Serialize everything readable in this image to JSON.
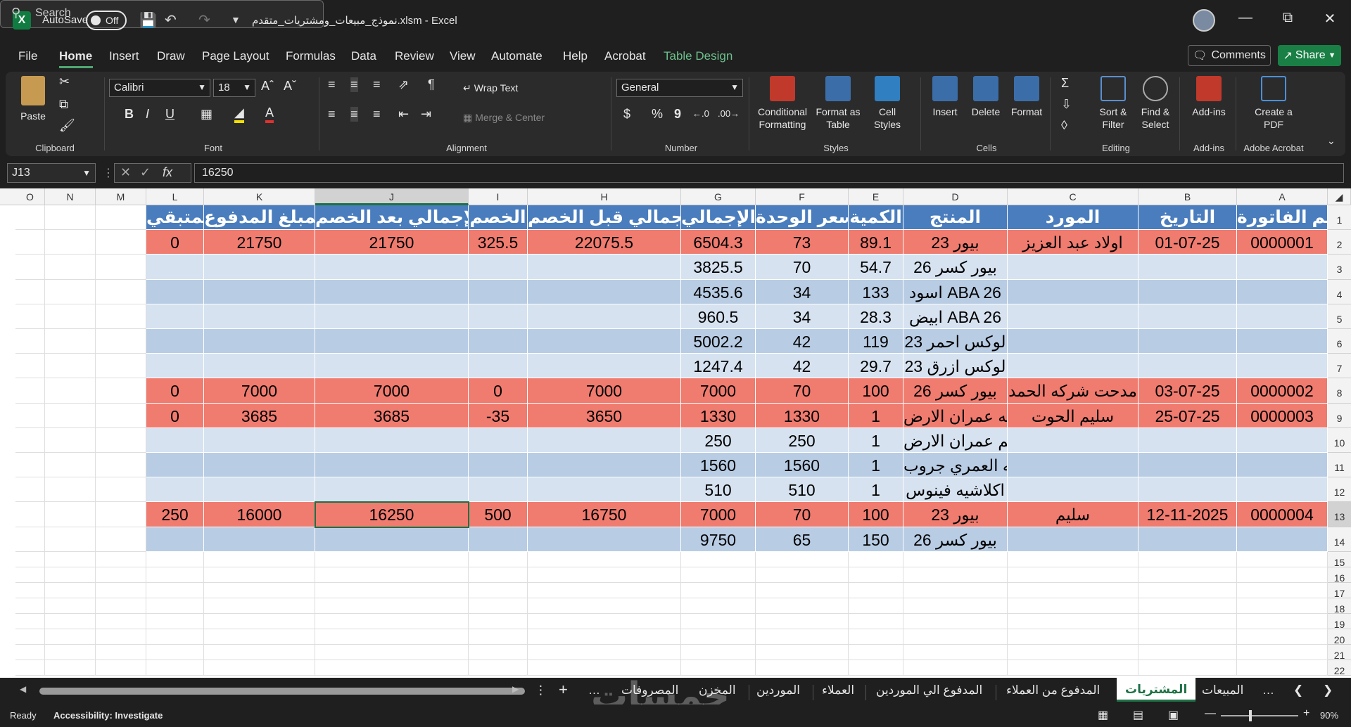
{
  "title_bar": {
    "app_icon": "X",
    "autosave_label": "AutoSave",
    "autosave_state": "Off",
    "file_title": "نموذج_مبيعات_ومشتريات_متقدم.xlsm  -  Excel",
    "search_placeholder": "Search",
    "search_icon": "search-icon"
  },
  "menu": {
    "tabs": [
      "File",
      "Home",
      "Insert",
      "Draw",
      "Page Layout",
      "Formulas",
      "Data",
      "Review",
      "View",
      "Automate",
      "Help",
      "Acrobat",
      "Table Design"
    ],
    "active": "Home",
    "comments_label": "Comments",
    "share_label": "Share"
  },
  "ribbon": {
    "clipboard": {
      "paste": "Paste",
      "label": "Clipboard"
    },
    "font": {
      "name": "Calibri",
      "size": "18",
      "label": "Font",
      "bold": "B",
      "italic": "I",
      "underline": "U"
    },
    "alignment": {
      "wrap_text": "Wrap Text",
      "merge_center": "Merge & Center",
      "label": "Alignment"
    },
    "number": {
      "format": "General",
      "label": "Number",
      "currency": "$",
      "percent": "%",
      "comma": "9"
    },
    "styles": {
      "conditional": "Conditional Formatting",
      "format_table": "Format as Table",
      "cell_styles": "Cell Styles",
      "label": "Styles"
    },
    "cells": {
      "insert": "Insert",
      "delete": "Delete",
      "format": "Format",
      "label": "Cells"
    },
    "editing": {
      "sort_filter": "Sort & Filter",
      "find_select": "Find & Select",
      "label": "Editing"
    },
    "addins": {
      "addins": "Add-ins",
      "label": "Add-ins"
    },
    "acrobat": {
      "create_pdf": "Create a PDF",
      "label": "Adobe Acrobat"
    }
  },
  "formula_bar": {
    "name_box": "J13",
    "fx": "fx",
    "value": "16250"
  },
  "columns": [
    "O",
    "N",
    "M",
    "L",
    "K",
    "J",
    "I",
    "H",
    "G",
    "F",
    "E",
    "D",
    "C",
    "B",
    "A"
  ],
  "selected_column": "J",
  "selected_row": "13",
  "table": {
    "headers": [
      "رقم الفاتورة",
      "التاريخ",
      "المورد",
      "المنتج",
      "الكمية",
      "سعر الوحدة",
      "الإجمالي",
      "الإجمالي قبل الخصم",
      "الخصم",
      "الإجمالي بعد الخصم",
      "المبلغ المدفوع",
      "المتبقي"
    ],
    "rows": [
      {
        "row": "2",
        "style": "red",
        "cells": [
          "0000001",
          "01-07-25",
          "اولاد عبد العزيز",
          "بيور 23",
          "89.1",
          "73",
          "6504.3",
          "22075.5",
          "325.5",
          "21750",
          "21750",
          "0"
        ]
      },
      {
        "row": "3",
        "style": "blue-a",
        "cells": [
          "",
          "",
          "",
          "بيور كسر 26",
          "54.7",
          "70",
          "3825.5",
          "",
          "",
          "",
          "",
          ""
        ]
      },
      {
        "row": "4",
        "style": "blue-b",
        "cells": [
          "",
          "",
          "",
          "اسود ABA 26",
          "133",
          "34",
          "4535.6",
          "",
          "",
          "",
          "",
          ""
        ]
      },
      {
        "row": "5",
        "style": "blue-a",
        "cells": [
          "",
          "",
          "",
          "ابيض ABA 26",
          "28.3",
          "34",
          "960.5",
          "",
          "",
          "",
          "",
          ""
        ]
      },
      {
        "row": "6",
        "style": "blue-b",
        "cells": [
          "",
          "",
          "",
          "لوكس احمر 23",
          "119",
          "42",
          "5002.2",
          "",
          "",
          "",
          "",
          ""
        ]
      },
      {
        "row": "7",
        "style": "blue-a",
        "cells": [
          "",
          "",
          "",
          "لوكس ازرق 23",
          "29.7",
          "42",
          "1247.4",
          "",
          "",
          "",
          "",
          ""
        ]
      },
      {
        "row": "8",
        "style": "red",
        "cells": [
          "0000002",
          "03-07-25",
          "مدحت شركه الحمد",
          "بيور كسر 26",
          "100",
          "70",
          "7000",
          "7000",
          "0",
          "7000",
          "7000",
          "0"
        ]
      },
      {
        "row": "9",
        "style": "red",
        "cells": [
          "0000003",
          "25-07-25",
          "سليم الحوت",
          "اكلاشيه عمران الارض",
          "1",
          "1330",
          "1330",
          "3650",
          "-35",
          "3685",
          "3685",
          "0"
        ]
      },
      {
        "row": "10",
        "style": "blue-a",
        "cells": [
          "",
          "",
          "",
          "ختم عمران الارض",
          "1",
          "250",
          "250",
          "",
          "",
          "",
          "",
          ""
        ]
      },
      {
        "row": "11",
        "style": "blue-b",
        "cells": [
          "",
          "",
          "",
          "اكلاشيه العمري جروب",
          "1",
          "1560",
          "1560",
          "",
          "",
          "",
          "",
          ""
        ]
      },
      {
        "row": "12",
        "style": "blue-a",
        "cells": [
          "",
          "",
          "",
          "اكلاشيه فينوس",
          "1",
          "510",
          "510",
          "",
          "",
          "",
          "",
          ""
        ]
      },
      {
        "row": "13",
        "style": "red",
        "cells": [
          "0000004",
          "12-11-2025",
          "سليم",
          "بيور 23",
          "100",
          "70",
          "7000",
          "16750",
          "500",
          "16250",
          "16000",
          "250"
        ]
      },
      {
        "row": "14",
        "style": "blue-b",
        "cells": [
          "",
          "",
          "",
          "بيور كسر 26",
          "150",
          "65",
          "9750",
          "",
          "",
          "",
          "",
          ""
        ]
      }
    ],
    "empty_rows": [
      "15",
      "16",
      "17",
      "18",
      "19",
      "20",
      "21",
      "22"
    ]
  },
  "sheet_tabs": [
    "المبيعات",
    "المشتريات",
    "المدفوع من العملاء",
    "المدفوع الي الموردين",
    "العملاء",
    "الموردين",
    "المخزن",
    "المصروفات"
  ],
  "active_sheet": "المشتريات",
  "status": {
    "ready": "Ready",
    "accessibility": "Accessibility: Investigate",
    "zoom": "90%"
  },
  "watermark": "خمسات"
}
